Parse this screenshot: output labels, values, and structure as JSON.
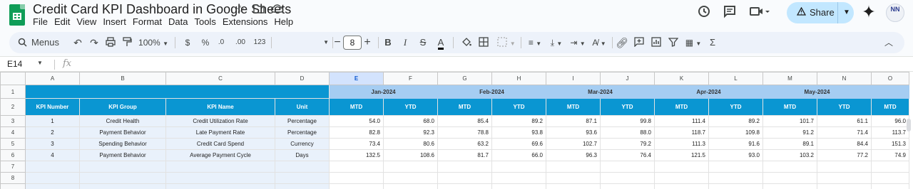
{
  "doc": {
    "title": "Credit Card KPI Dashboard in Google Sheets",
    "menus": [
      "File",
      "Edit",
      "View",
      "Insert",
      "Format",
      "Data",
      "Tools",
      "Extensions",
      "Help"
    ],
    "share_label": "Share",
    "avatar_text": "NN"
  },
  "toolbar": {
    "search_label": "Menus",
    "zoom": "100%",
    "currency": "$",
    "percent": "%",
    "dec_decrease": ".0",
    "dec_increase": ".00",
    "number_format": "123",
    "font_size": "8",
    "bold": "B",
    "italic": "I",
    "text_color": "A",
    "sum": "Σ"
  },
  "formula_bar": {
    "cell_ref": "E14",
    "fx": "fx"
  },
  "columns": [
    "A",
    "B",
    "C",
    "D",
    "E",
    "F",
    "G",
    "H",
    "I",
    "J",
    "K",
    "L",
    "M",
    "N",
    "O"
  ],
  "selected_column": "E",
  "row_numbers": [
    "1",
    "2",
    "3",
    "4",
    "5",
    "6",
    "7",
    "8"
  ],
  "months": [
    "Jan-2024",
    "Feb-2024",
    "Mar-2024",
    "Apr-2024",
    "May-2024"
  ],
  "headers": {
    "kpi_number": "KPI Number",
    "kpi_group": "KPI Group",
    "kpi_name": "KPI Name",
    "unit": "Unit",
    "mtd": "MTD",
    "ytd": "YTD"
  },
  "rows": [
    {
      "num": "1",
      "group": "Credit Health",
      "name": "Credit Utilization Rate",
      "unit": "Percentage",
      "values": [
        "54.0",
        "68.0",
        "85.4",
        "89.2",
        "87.1",
        "99.8",
        "111.4",
        "89.2",
        "101.7",
        "61.1",
        "96.0"
      ]
    },
    {
      "num": "2",
      "group": "Payment Behavior",
      "name": "Late Payment Rate",
      "unit": "Percentage",
      "values": [
        "82.8",
        "92.3",
        "78.8",
        "93.8",
        "93.6",
        "88.0",
        "118.7",
        "109.8",
        "91.2",
        "71.4",
        "113.7"
      ]
    },
    {
      "num": "3",
      "group": "Spending Behavior",
      "name": "Credit Card Spend",
      "unit": "Currency",
      "values": [
        "73.4",
        "80.6",
        "63.2",
        "69.6",
        "102.7",
        "79.2",
        "111.3",
        "91.6",
        "89.1",
        "84.4",
        "151.3"
      ]
    },
    {
      "num": "4",
      "group": "Payment Behavior",
      "name": "Average Payment Cycle",
      "unit": "Days",
      "values": [
        "132.5",
        "108.6",
        "81.7",
        "66.0",
        "96.3",
        "76.4",
        "121.5",
        "93.0",
        "103.2",
        "77.2",
        "74.9"
      ]
    }
  ]
}
